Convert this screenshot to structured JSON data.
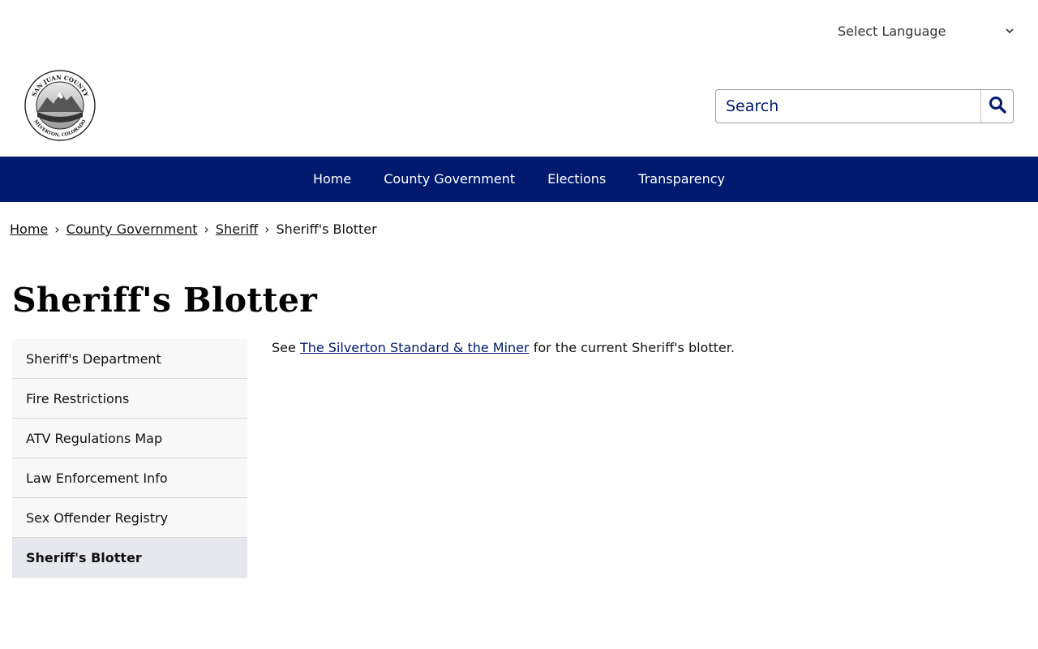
{
  "language": {
    "label": "Select Language"
  },
  "logo": {
    "top_text": "SAN JUAN COUNTY",
    "bottom_text": "SILVERTON, COLORADO"
  },
  "search": {
    "placeholder": "Search"
  },
  "nav": {
    "items": [
      {
        "label": "Home"
      },
      {
        "label": "County Government"
      },
      {
        "label": "Elections"
      },
      {
        "label": "Transparency"
      }
    ]
  },
  "breadcrumb": {
    "items": [
      {
        "label": "Home"
      },
      {
        "label": "County Government"
      },
      {
        "label": "Sheriff"
      }
    ],
    "current": "Sheriff's Blotter",
    "separator": "›"
  },
  "page": {
    "title": "Sheriff's Blotter"
  },
  "sidebar": {
    "items": [
      {
        "label": "Sheriff's Department"
      },
      {
        "label": "Fire Restrictions"
      },
      {
        "label": "ATV Regulations Map"
      },
      {
        "label": "Law Enforcement Info"
      },
      {
        "label": "Sex Offender Registry"
      },
      {
        "label": "Sheriff's Blotter",
        "active": true
      }
    ]
  },
  "content": {
    "prefix": "See",
    "link_text": "The Silverton Standard & the Miner",
    "suffix": "for the current Sheriff's blotter."
  },
  "colors": {
    "nav_bg": "#001a70",
    "link": "#001a70",
    "sidebar_bg": "#f8f8f8",
    "sidebar_active_bg": "#e6e8ed"
  },
  "icons": {
    "language": "chevron-down-icon",
    "search": "search-icon"
  }
}
